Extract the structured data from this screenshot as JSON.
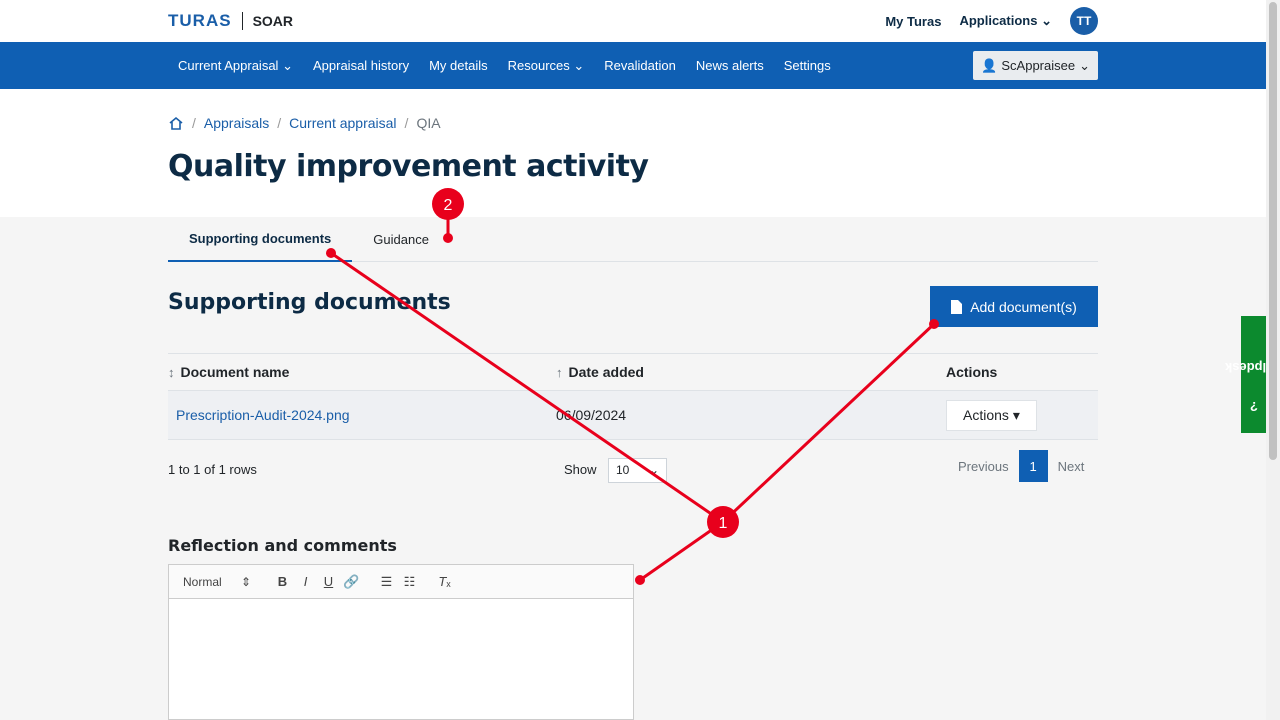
{
  "brand": {
    "logo": "TURAS",
    "app": "SOAR"
  },
  "top_links": {
    "my_turas": "My Turas",
    "applications": "Applications",
    "avatar": "TT"
  },
  "nav": {
    "items": [
      "Current Appraisal",
      "Appraisal history",
      "My details",
      "Resources",
      "Revalidation",
      "News alerts",
      "Settings"
    ],
    "user": "ScAppraisee"
  },
  "breadcrumb": {
    "items": [
      "Appraisals",
      "Current appraisal"
    ],
    "current": "QIA"
  },
  "page_title": "Quality improvement activity",
  "tabs": [
    "Supporting documents",
    "Guidance"
  ],
  "section": {
    "title": "Supporting documents",
    "add_button": "Add document(s)"
  },
  "table": {
    "headers": [
      "Document name",
      "Date added",
      "Actions"
    ],
    "rows": [
      {
        "name": "Prescription-Audit-2024.png",
        "date": "06/09/2024",
        "action": "Actions"
      }
    ]
  },
  "pagination": {
    "rows_info": "1 to 1 of 1 rows",
    "show_label": "Show",
    "page_size": "10",
    "previous": "Previous",
    "page": "1",
    "next": "Next"
  },
  "reflection": {
    "label": "Reflection and comments",
    "format": "Normal"
  },
  "helpdesk": "Helpdesk",
  "annotations": {
    "marker_1": "1",
    "marker_2": "2"
  },
  "colors": {
    "primary": "#0f5fb3",
    "title": "#0d2b45",
    "helpdesk": "#0c8a2e",
    "annotation": "#e8001c"
  }
}
